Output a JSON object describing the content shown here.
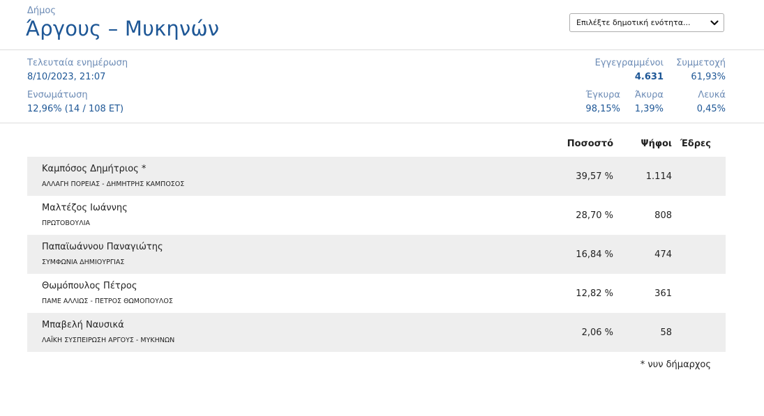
{
  "header": {
    "kicker": "Δήμος",
    "title": "Άργους – Μυκηνών",
    "select_text": "Επιλέξτε δημοτική ενότητα..."
  },
  "stats": {
    "updated_label": "Τελευταία ενημέρωση",
    "updated_value": "8/10/2023, 21:07",
    "incorporation_label": "Ενσωμάτωση",
    "incorporation_value": "12,96% (14 / 108 ΕΤ)",
    "registered_label": "Εγγεγραμμένοι",
    "registered_value": "4.631",
    "turnout_label": "Συμμετοχή",
    "turnout_value": "61,93%",
    "valid_label": "Έγκυρα",
    "valid_value": "98,15%",
    "invalid_label": "Άκυρα",
    "invalid_value": "1,39%",
    "blank_label": "Λευκά",
    "blank_value": "0,45%"
  },
  "table": {
    "headers": {
      "percent": "Ποσοστό",
      "votes": "Ψήφοι",
      "seats": "Έδρες"
    },
    "rows": [
      {
        "name": "Καμπόσος Δημήτριος *",
        "party": "ΑΛΛΑΓΗ ΠΟΡΕΙΑΣ - ΔΗΜΗΤΡΗΣ ΚΑΜΠΟΣΟΣ",
        "percent": "39,57 %",
        "votes": "1.114",
        "seats": ""
      },
      {
        "name": "Μαλτέζος Ιωάννης",
        "party": "ΠΡΩΤΟΒΟΥΛΙΑ",
        "percent": "28,70 %",
        "votes": "808",
        "seats": ""
      },
      {
        "name": "Παπαϊωάννου Παναγιώτης",
        "party": "ΣΥΜΦΩΝΙΑ ΔΗΜΙΟΥΡΓΙΑΣ",
        "percent": "16,84 %",
        "votes": "474",
        "seats": ""
      },
      {
        "name": "Θωμόπουλος Πέτρος",
        "party": "ΠΑΜΕ ΑΛΛΙΩΣ - ΠΕΤΡΟΣ ΘΩΜΟΠΟΥΛΟΣ",
        "percent": "12,82 %",
        "votes": "361",
        "seats": ""
      },
      {
        "name": "Μπαβελή Ναυσικά",
        "party": "ΛΑΪΚΗ ΣΥΣΠΕΙΡΩΣΗ ΑΡΓΟΥΣ - ΜΥΚΗΝΩΝ",
        "percent": "2,06 %",
        "votes": "58",
        "seats": ""
      }
    ],
    "footnote": "* νυν δήμαρχος"
  },
  "icons": {
    "select_arrow": "chevron-down-icon"
  },
  "colors": {
    "title": "#1e5796",
    "label": "#6c8bb5",
    "row_shade": "#eeeeee"
  }
}
